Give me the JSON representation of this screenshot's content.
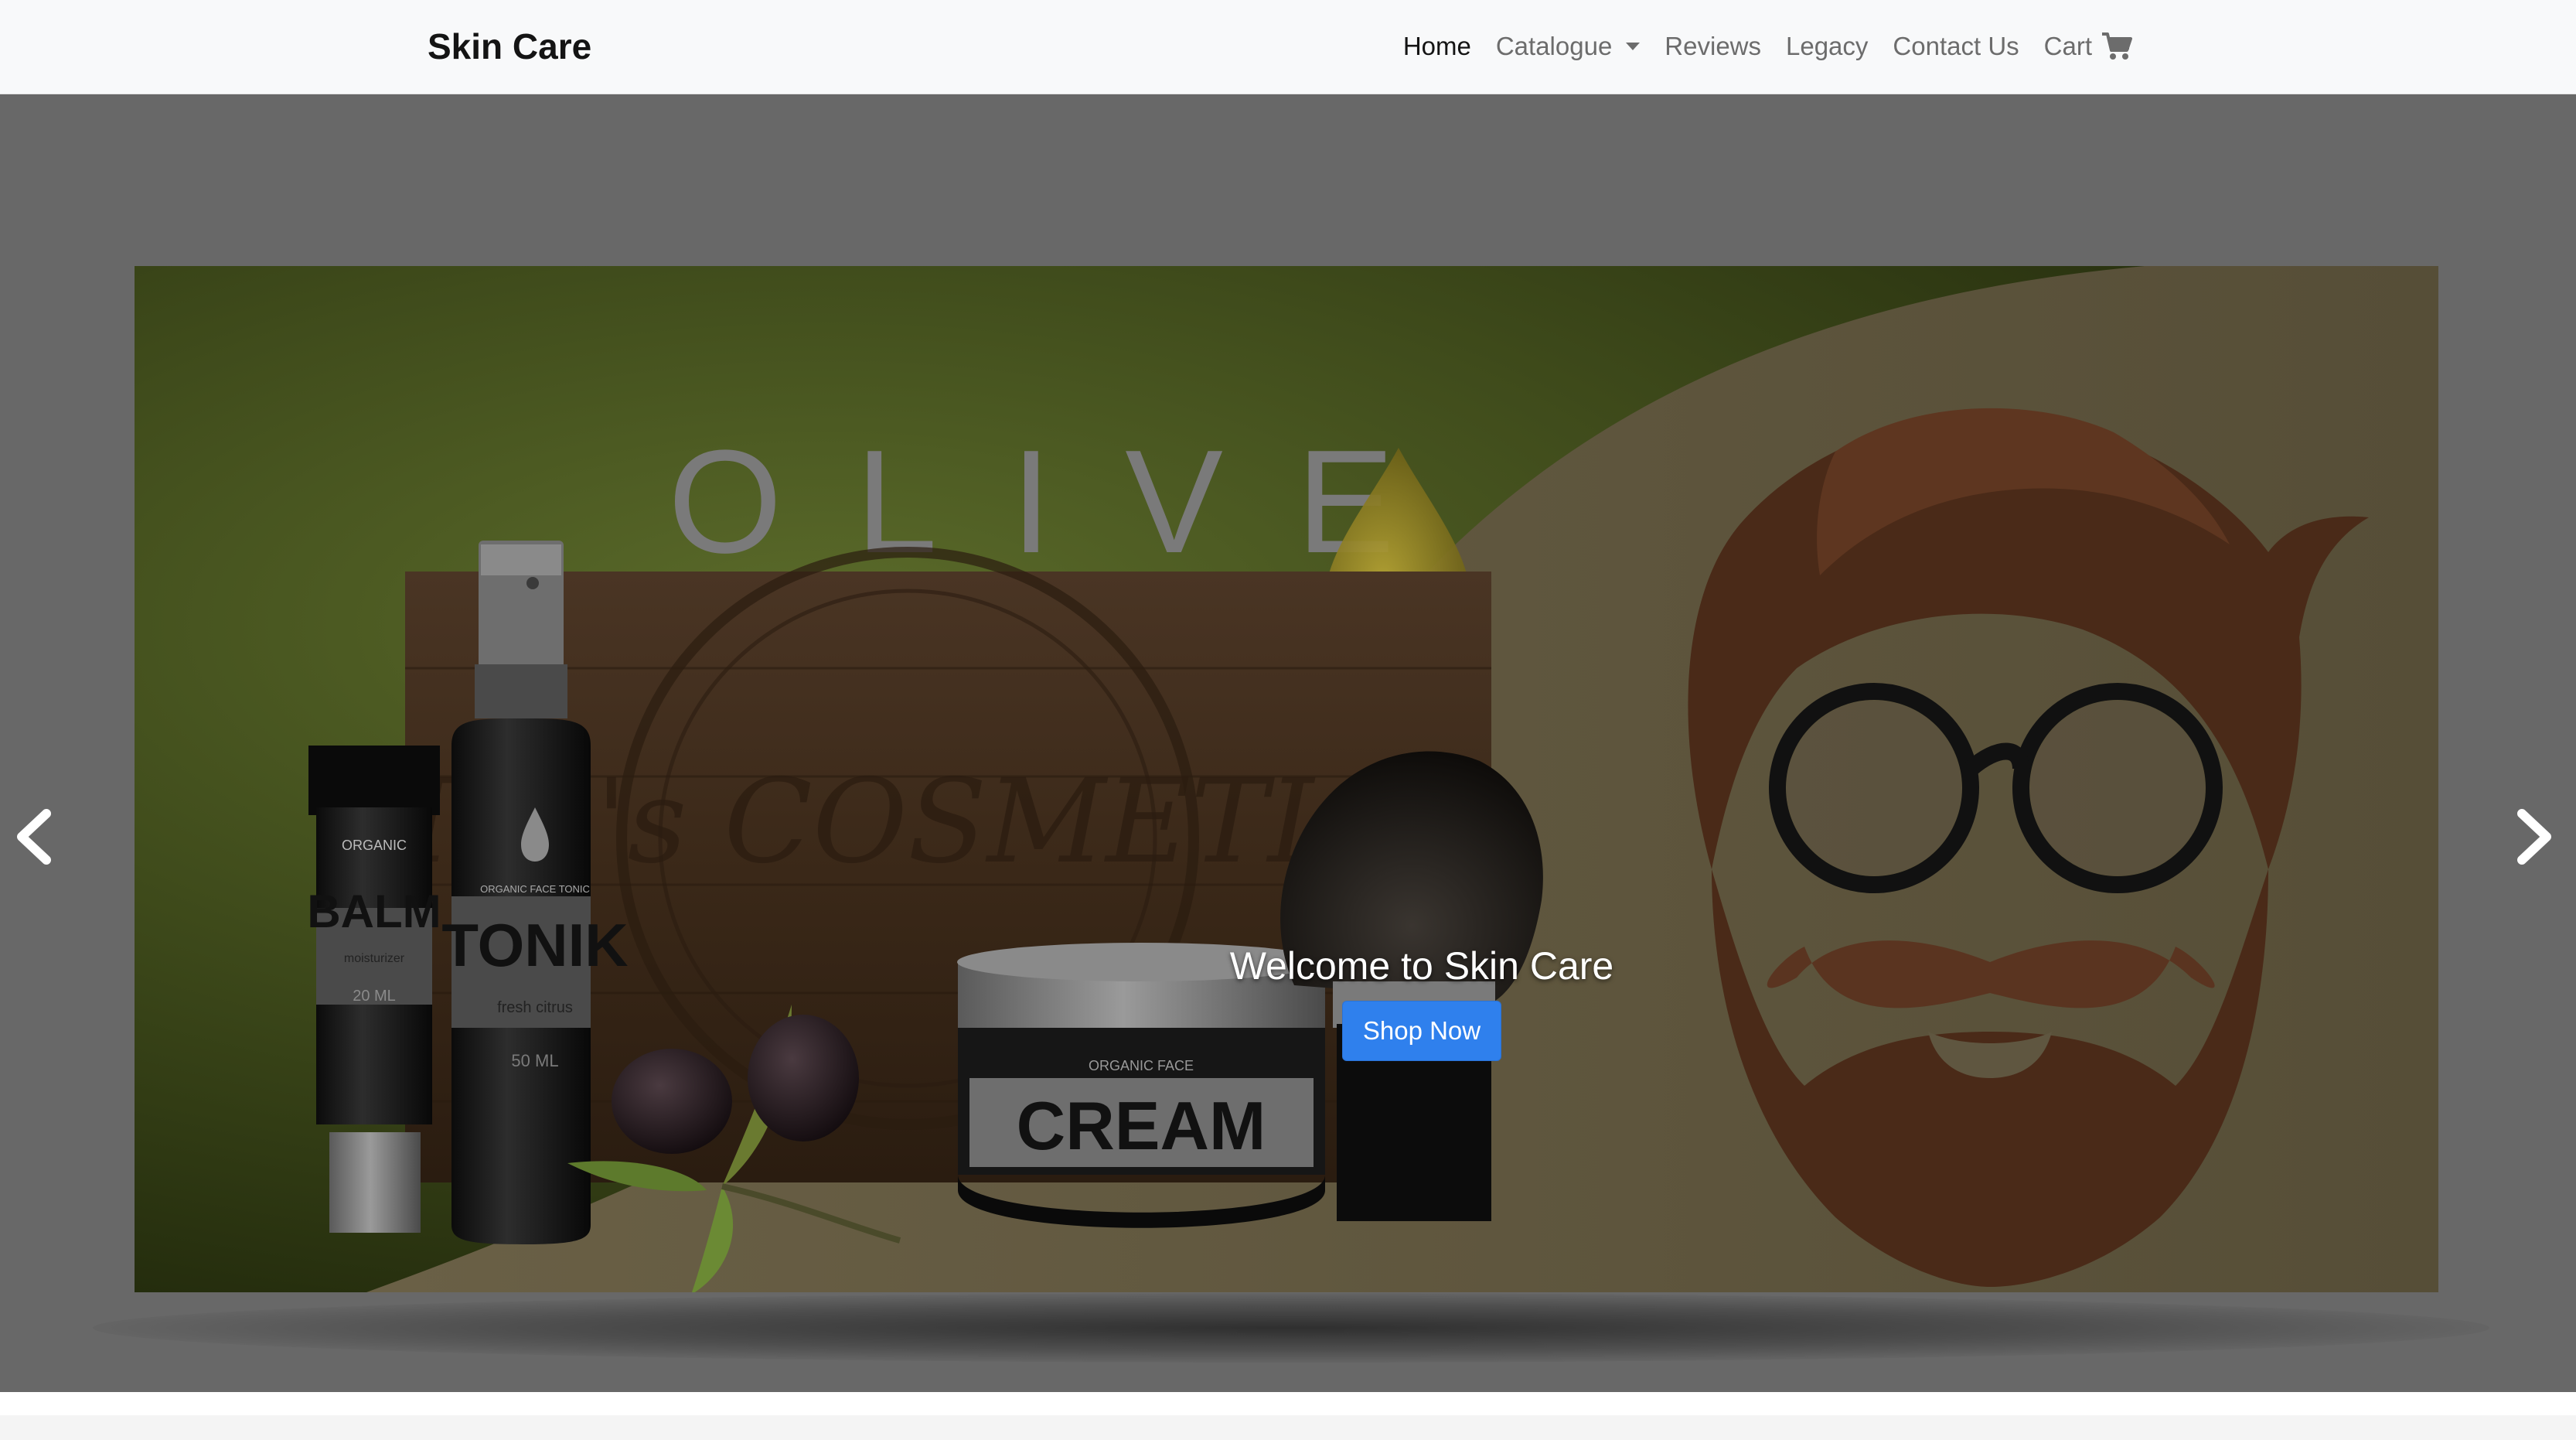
{
  "navbar": {
    "brand": "Skin Care",
    "links": {
      "home": "Home",
      "catalogue": "Catalogue",
      "reviews": "Reviews",
      "legacy": "Legacy",
      "contact": "Contact Us",
      "cart": "Cart"
    },
    "icons": {
      "catalogue": "caret-down-icon",
      "cart": "shopping-cart-icon"
    }
  },
  "carousel": {
    "caption_title": "Welcome to Skin Care",
    "cta_label": "Shop Now",
    "prev_icon": "chevron-left-icon",
    "next_icon": "chevron-right-icon",
    "banner_text": {
      "headline": "OLIVE",
      "crate": "Men's COSMETICS",
      "balm_top": "ORGANIC",
      "balm_name": "BALM",
      "balm_sub": "moisturizer",
      "balm_volume": "20 ML",
      "tonik_top": "ORGANIC FACE TONIC",
      "tonik_name": "TONIK",
      "tonik_sub": "fresh citrus",
      "tonik_volume": "50 ML",
      "cream_top": "ORGANIC FACE",
      "cream_name": "CREAM"
    }
  },
  "colors": {
    "navbar_bg": "#f8f9fa",
    "hero_bg": "#686868",
    "banner_olive": "#3f4b1b",
    "banner_tan": "#5f5640",
    "cta_blue": "#2f80ed",
    "hair_brown": "#4a2a18"
  }
}
